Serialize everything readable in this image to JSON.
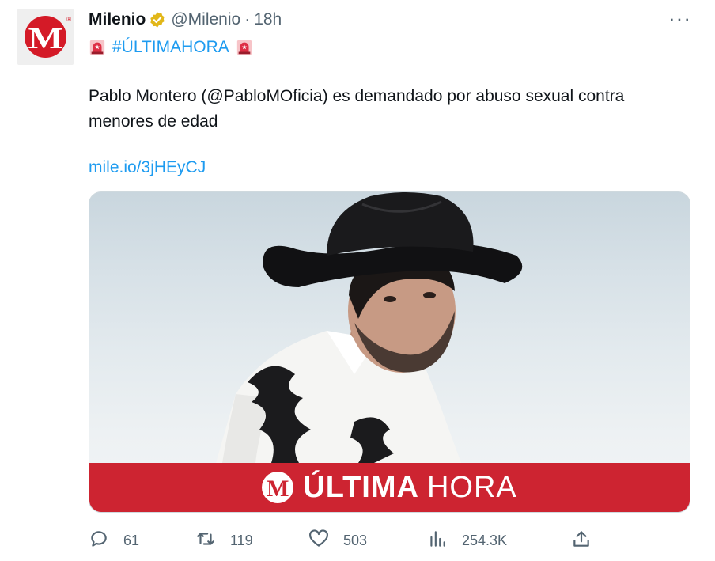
{
  "tweet": {
    "author_name": "Milenio",
    "handle": "@Milenio",
    "separator": "·",
    "time": "18h",
    "avatar_letter": "M",
    "avatar_mark": "®",
    "hashtag": "#ÚLTIMAHORA",
    "body_text": "Pablo Montero (@PabloMOficia) es demandado por abuso sexual contra menores de edad",
    "link": "mile.io/3jHEyCJ",
    "more_label": "···"
  },
  "media": {
    "banner_logo_letter": "M",
    "banner_bold": "ÚLTIMA",
    "banner_light": "HORA"
  },
  "actions": {
    "replies": "61",
    "retweets": "119",
    "likes": "503",
    "views": "254.3K"
  },
  "colors": {
    "accent": "#1d9bf0",
    "brand_red": "#d41a27",
    "verified_gold": "#e2b719",
    "muted": "#536471"
  },
  "icons": [
    "verified-badge-icon",
    "siren-icon",
    "reply-icon",
    "retweet-icon",
    "like-icon",
    "views-icon",
    "share-icon",
    "more-icon"
  ]
}
